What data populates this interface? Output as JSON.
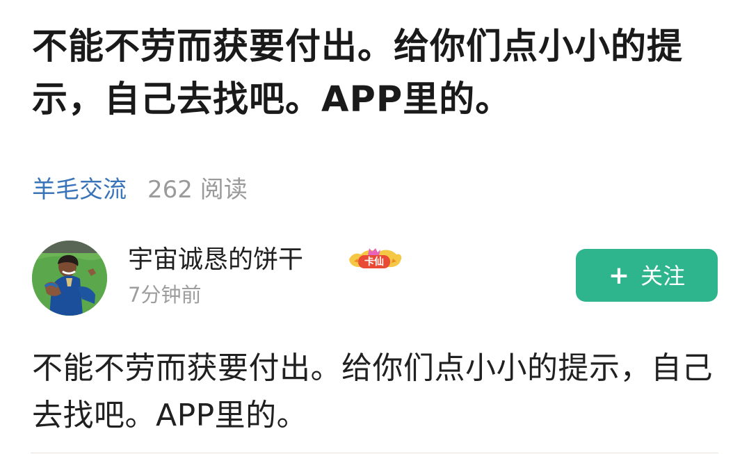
{
  "post": {
    "title": "不能不劳而获要付出。给你们点小小的提示，自己去找吧。APP里的。",
    "category": "羊毛交流",
    "reads": "262 阅读",
    "author": {
      "name": "宇宙诚恳的饼干",
      "badge": "卡仙",
      "time": "7分钟前"
    },
    "follow_button": {
      "plus": "+",
      "label": "关注"
    },
    "content": "不能不劳而获要付出。给你们点小小的提示，自己去找吧。APP里的。"
  },
  "colors": {
    "category": "#3a74b8",
    "follow_button": "#2eb58e",
    "muted_text": "#9a9a9a"
  },
  "icons": {
    "avatar": "profile-photo",
    "badge": "crown-badge-icon",
    "follow": "plus-icon"
  }
}
